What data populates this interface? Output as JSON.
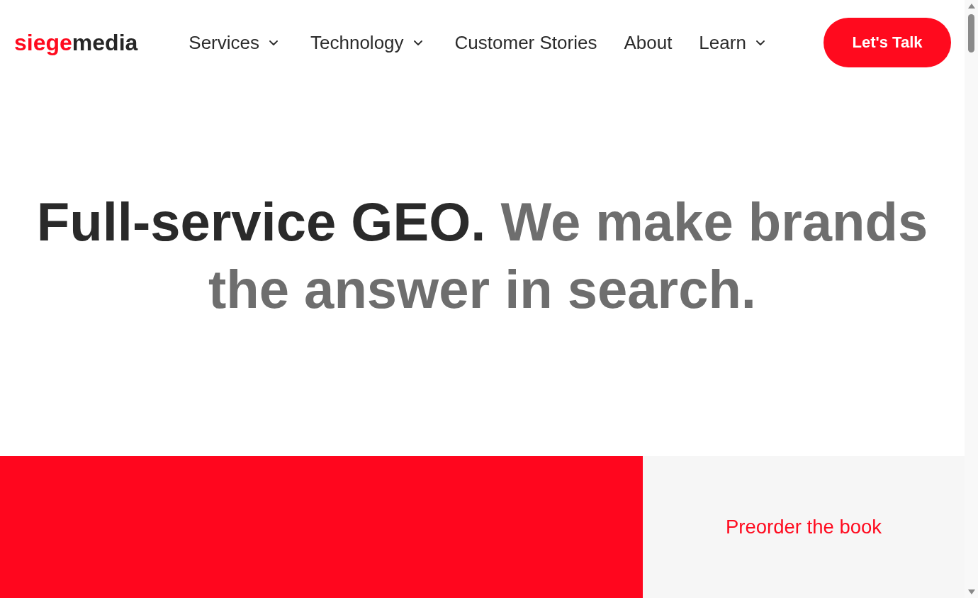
{
  "header": {
    "logo": {
      "lead": "siege",
      "tail": "media"
    },
    "nav": [
      {
        "label": "Services",
        "has_menu": true
      },
      {
        "label": "Technology",
        "has_menu": true
      },
      {
        "label": "Customer Stories",
        "has_menu": false
      },
      {
        "label": "About",
        "has_menu": false
      },
      {
        "label": "Learn",
        "has_menu": true
      }
    ],
    "cta": "Let's Talk"
  },
  "hero": {
    "headline_lead": "Full-service GEO.",
    "headline_rest": "We make brands the answer in search."
  },
  "promo": {
    "link": "Preorder the book"
  }
}
